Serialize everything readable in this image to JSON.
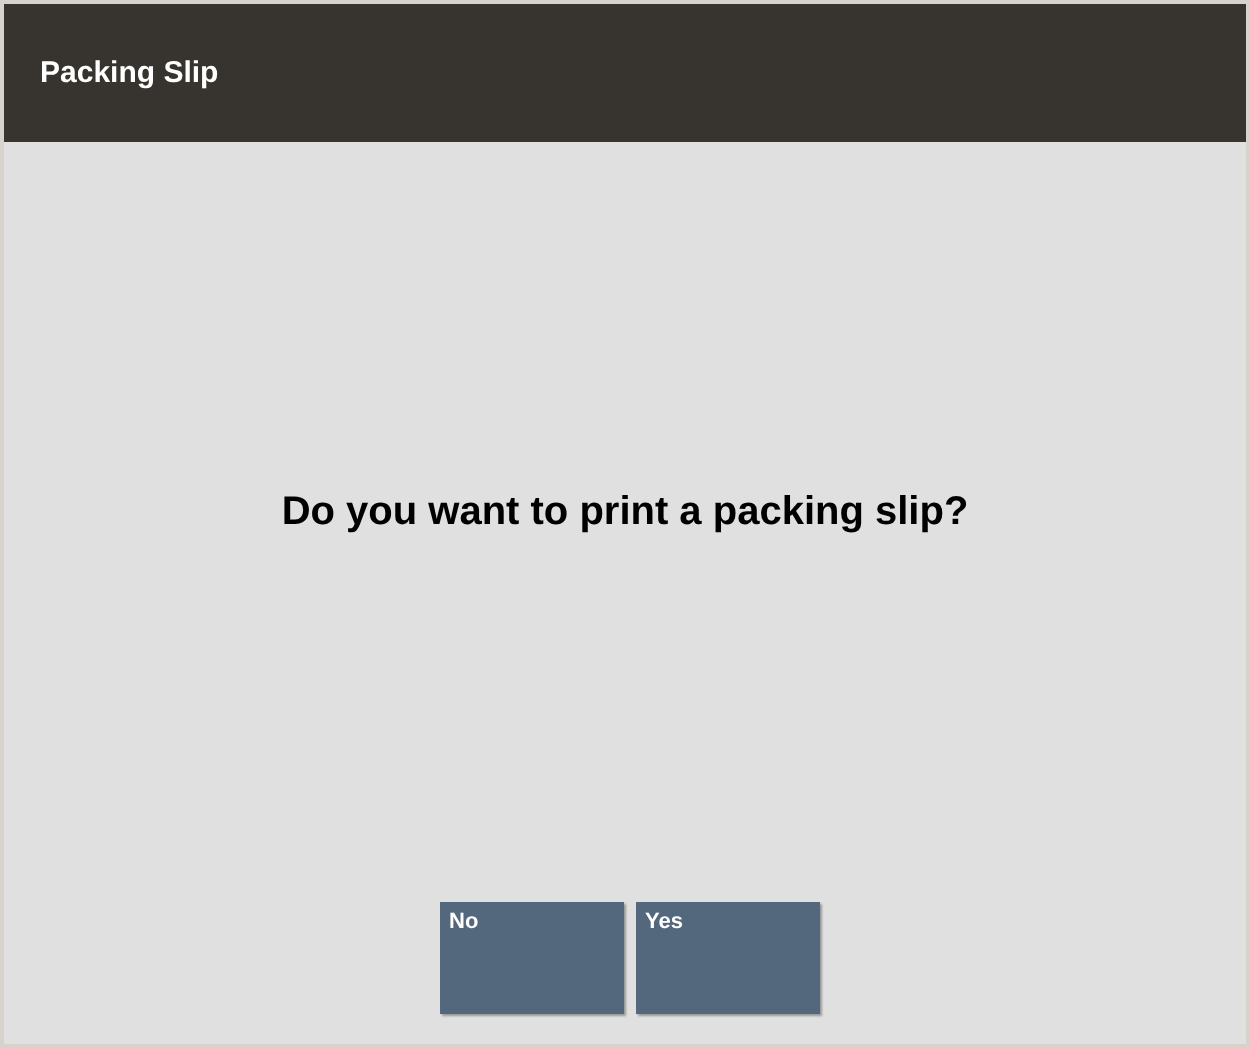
{
  "header": {
    "title": "Packing Slip"
  },
  "prompt": "Do you want to print a packing slip?",
  "buttons": [
    {
      "label": "No"
    },
    {
      "label": "Yes"
    }
  ]
}
